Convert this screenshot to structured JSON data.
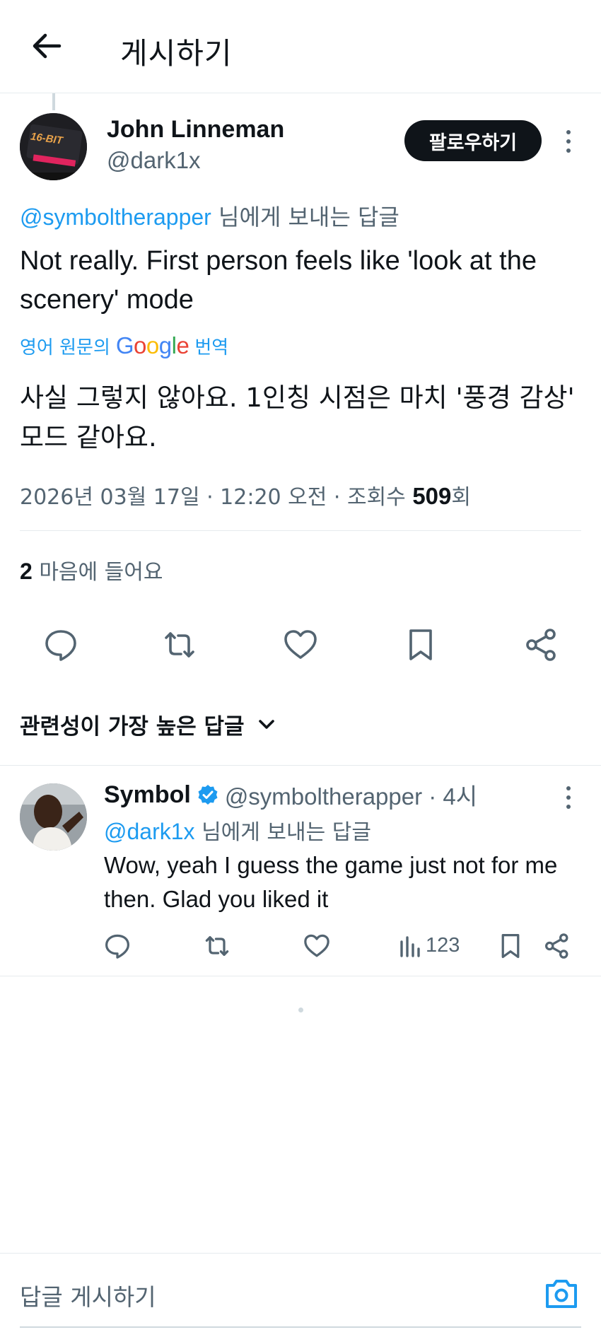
{
  "header": {
    "title": "게시하기",
    "back_icon": "arrow-left-icon"
  },
  "tweet": {
    "author_name": "John Linneman",
    "author_handle": "@dark1x",
    "avatar_text": "16-BIT",
    "follow_label": "팔로우하기",
    "reply_to_handle": "@symboltherapper",
    "reply_to_suffix": " 님에게 보내는 답글",
    "text": "Not really. First person feels like 'look at the scenery' mode",
    "translate_prefix": "영어 원문의",
    "translate_brand": "Google",
    "translate_suffix": "번역",
    "translated_text": "사실 그렇지 않아요. 1인칭 시점은 마치 '풍경 감상' 모드 같아요.",
    "meta_date": "2026년 03월 17일 · 12:20 오전 · 조회수 ",
    "views": "509",
    "views_suffix": "회",
    "likes_count": "2",
    "likes_label": " 마음에 들어요"
  },
  "actions": [
    "reply-icon",
    "retweet-icon",
    "heart-icon",
    "bookmark-icon",
    "share-icon"
  ],
  "sort": {
    "label": "관련성이 가장 높은 답글"
  },
  "reply": {
    "name": "Symbol",
    "handle": "@symboltherapper · 4시",
    "reply_to_handle": "@dark1x",
    "reply_to_suffix": " 님에게 보내는 답글",
    "text": "Wow, yeah I guess the game just not for me then. Glad you liked it",
    "views": "123"
  },
  "compose": {
    "placeholder": "답글 게시하기"
  },
  "colors": {
    "accent": "#1d9bf0",
    "text": "#0f1419",
    "secondary": "#536471",
    "border": "#e6ebee",
    "avatar_stripe": "#e0245e"
  }
}
